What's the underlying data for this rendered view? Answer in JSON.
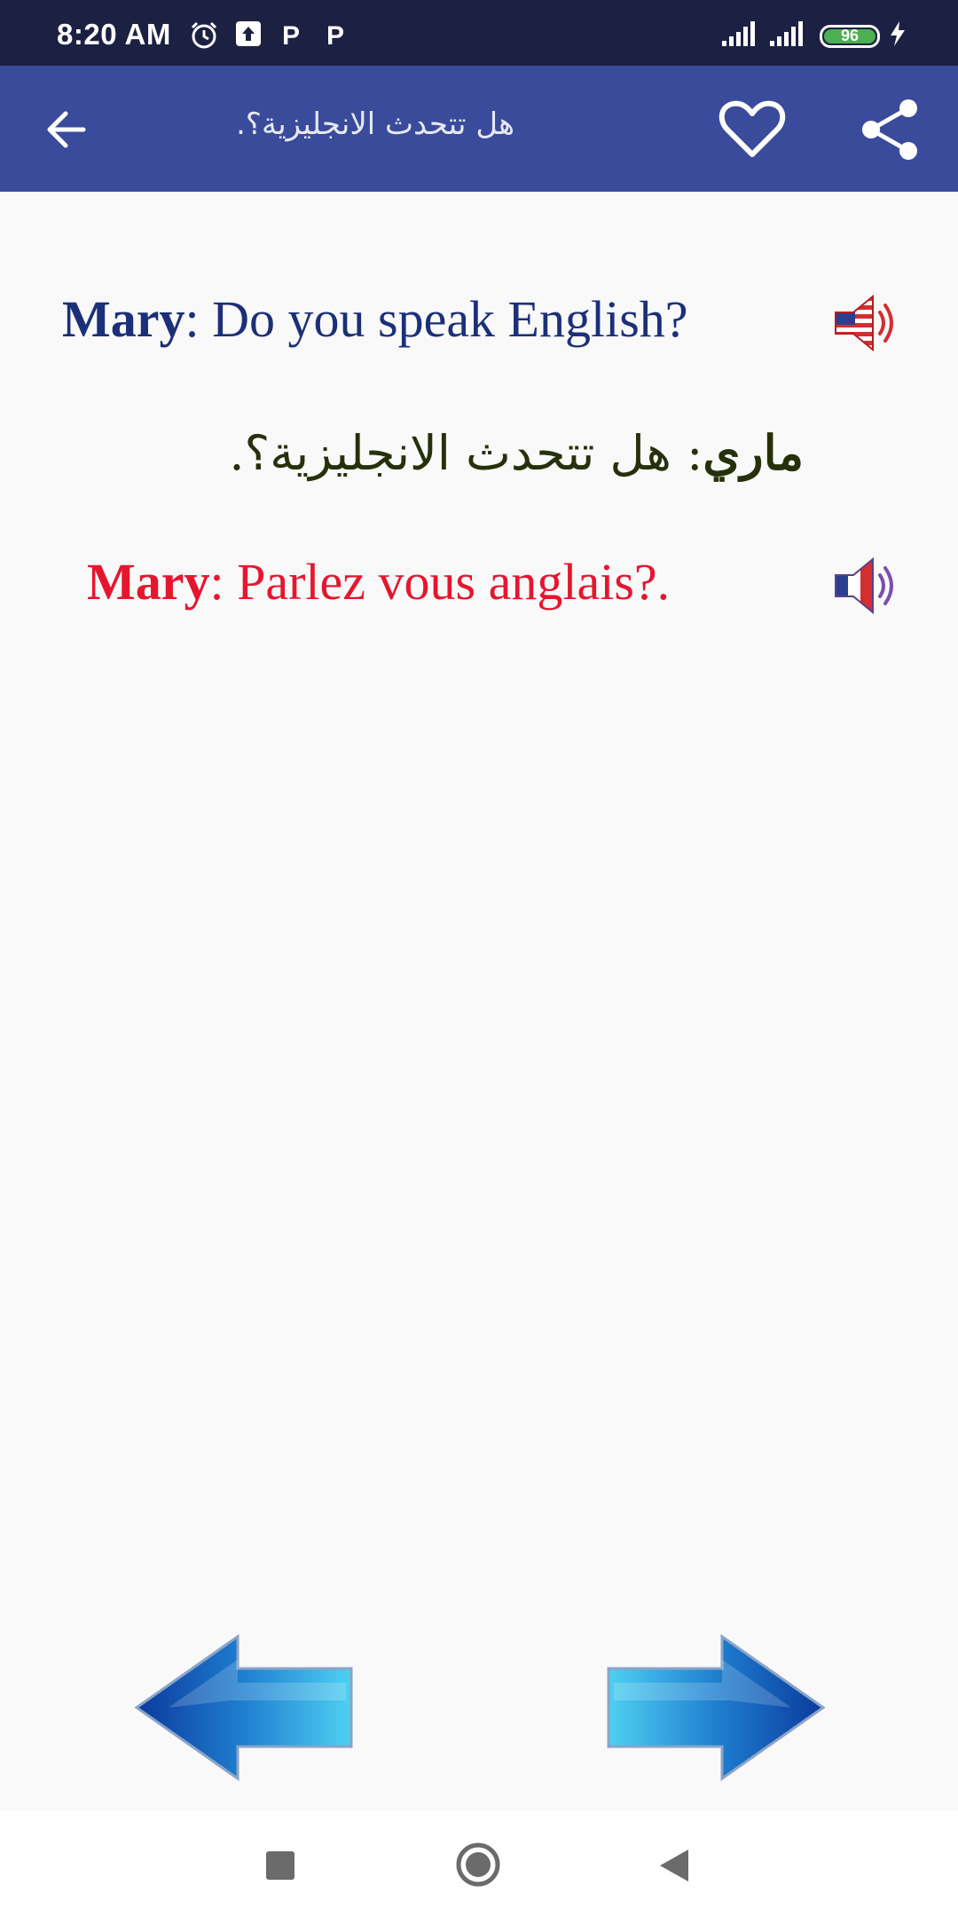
{
  "status_bar": {
    "time": "8:20 AM",
    "battery": "96",
    "left_icons": [
      "alarm-icon",
      "upload-icon",
      "p-icon",
      "p-icon"
    ],
    "right_icons": [
      "signal-icon",
      "signal-icon",
      "battery-icon",
      "charging-icon"
    ]
  },
  "app_bar": {
    "title": "هل تتحدث الانجليزية؟.",
    "background": "#3a4b9c",
    "icons": [
      "back-arrow-icon",
      "heart-icon",
      "share-icon"
    ]
  },
  "phrase": {
    "english": {
      "speaker": "Mary",
      "text": ": Do you speak English?",
      "color": "#1b3079"
    },
    "arabic": {
      "speaker": "ماري",
      "text": ": هل تتحدث الانجليزية؟.",
      "color": "#26310b"
    },
    "french": {
      "speaker": "Mary",
      "text": ": Parlez vous anglais?.",
      "color": "#e6162e"
    }
  },
  "navigation": {
    "icons": [
      "previous-arrow-icon",
      "next-arrow-icon"
    ]
  },
  "system_nav": {
    "icons": [
      "recents-square-icon",
      "home-circle-icon",
      "back-triangle-icon"
    ]
  }
}
